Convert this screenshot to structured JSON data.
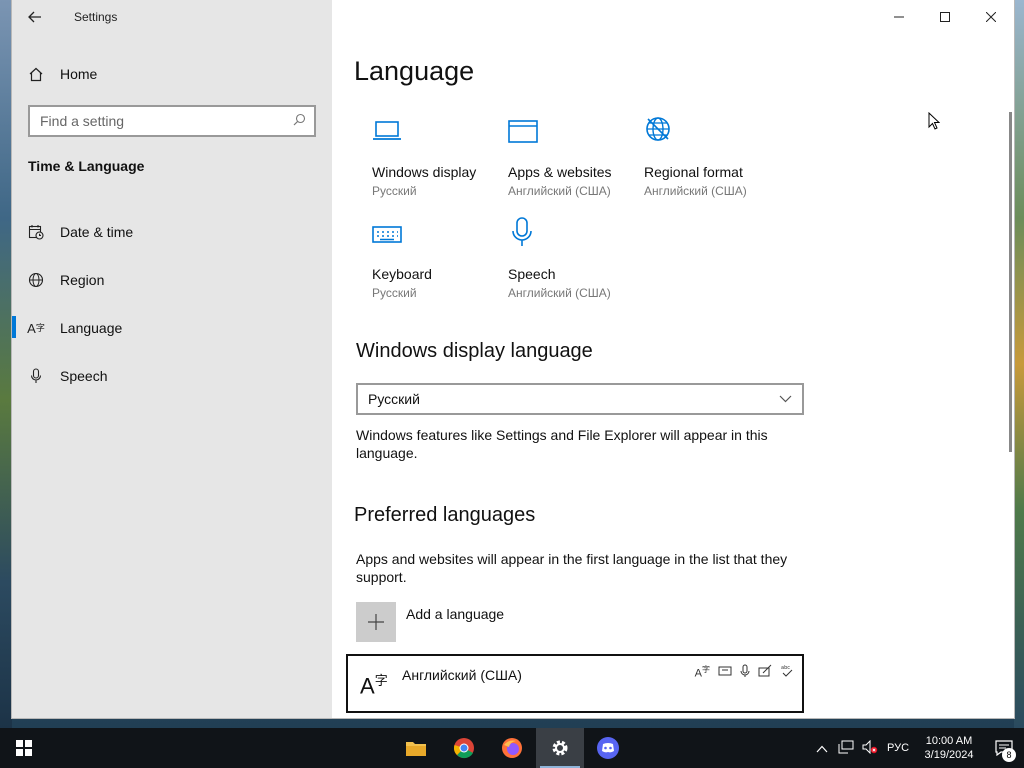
{
  "window": {
    "app_title": "Settings",
    "controls": {
      "minimize": "—",
      "maximize": "☐",
      "close": "✕"
    }
  },
  "sidebar": {
    "home_label": "Home",
    "search_placeholder": "Find a setting",
    "section_title": "Time & Language",
    "items": [
      {
        "label": "Date & time",
        "icon": "calendar-clock-icon"
      },
      {
        "label": "Region",
        "icon": "globe-icon"
      },
      {
        "label": "Language",
        "icon": "language-icon",
        "active": true
      },
      {
        "label": "Speech",
        "icon": "microphone-icon"
      }
    ]
  },
  "main": {
    "page_title": "Language",
    "tiles": [
      {
        "label": "Windows display",
        "sub": "Русский",
        "icon": "laptop-icon"
      },
      {
        "label": "Apps & websites",
        "sub": "Английский (США)",
        "icon": "window-icon"
      },
      {
        "label": "Regional format",
        "sub": "Английский (США)",
        "icon": "globe-settings-icon"
      },
      {
        "label": "Keyboard",
        "sub": "Русский",
        "icon": "keyboard-icon"
      },
      {
        "label": "Speech",
        "sub": "Английский (США)",
        "icon": "microphone-icon"
      }
    ],
    "display_language": {
      "heading": "Windows display language",
      "selected": "Русский",
      "description": "Windows features like Settings and File Explorer will appear in this language."
    },
    "preferred": {
      "heading": "Preferred languages",
      "description": "Apps and websites will appear in the first language in the list that they support.",
      "add_label": "Add a language",
      "languages": [
        {
          "name": "Английский (США)"
        }
      ]
    }
  },
  "taskbar": {
    "apps": [
      "file-explorer-icon",
      "chrome-icon",
      "firefox-icon",
      "settings-icon",
      "discord-icon"
    ],
    "input_language": "РУС",
    "time": "10:00 AM",
    "date": "3/19/2024",
    "notification_count": "8"
  },
  "colors": {
    "accent": "#0078d7",
    "sidebar_bg": "#e6e6e6",
    "taskbar_bg": "#101418"
  }
}
